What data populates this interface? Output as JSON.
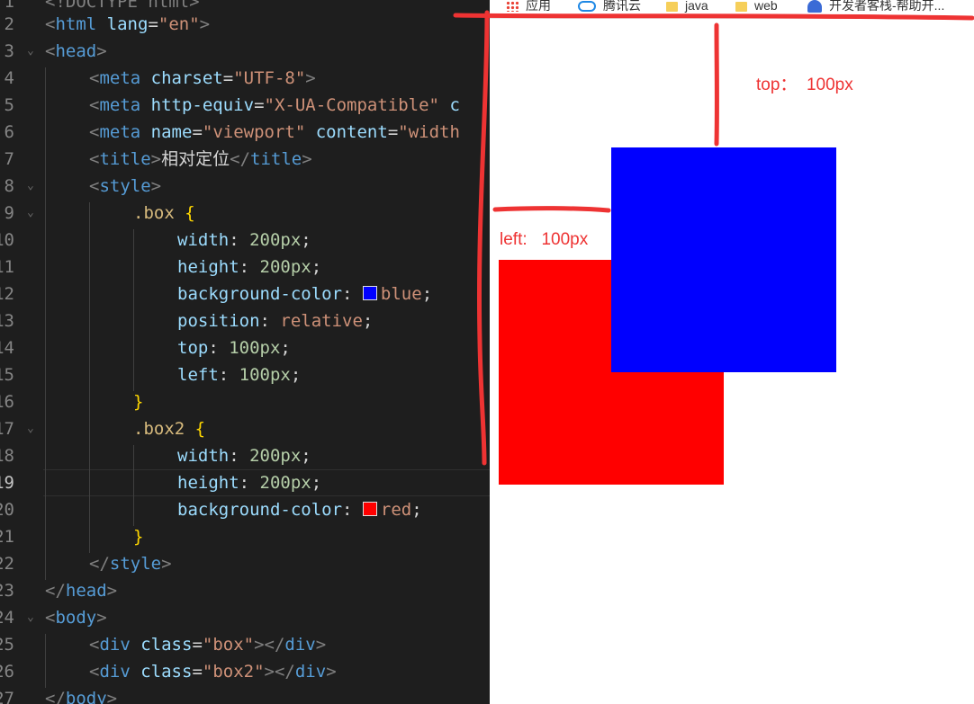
{
  "editor": {
    "line_numbers": [
      "1",
      "2",
      "3",
      "4",
      "5",
      "6",
      "7",
      "8",
      "9",
      "10",
      "11",
      "12",
      "13",
      "14",
      "15",
      "16",
      "17",
      "18",
      "19",
      "20",
      "21",
      "22",
      "23",
      "24",
      "25",
      "26",
      "27"
    ],
    "active_line": "19",
    "code": {
      "l1_text": "<!DOCTYPE html>",
      "l2_lang": "\"en\"",
      "l4_charset": "\"UTF-8\"",
      "l5_equiv": "\"X-UA-Compatible\"",
      "l5_rest": "c",
      "l6_viewport": "\"viewport\"",
      "l6_content": "\"width",
      "l7_title": "相对定位",
      "sel_box": ".box",
      "sel_box2": ".box2",
      "width_value": "200px",
      "height_value": "200px",
      "color_blue": "blue",
      "color_red": "red",
      "position_value": "relative",
      "top_value": "100px",
      "left_value": "100px",
      "class_box": "\"box\"",
      "class_box2": "\"box2\""
    },
    "swatch_colors": {
      "blue": "#0000ff",
      "red": "#ff0000"
    }
  },
  "browser": {
    "bookmarks": [
      {
        "label": "应用",
        "icon": "apps-grid-icon"
      },
      {
        "label": "腾讯云",
        "icon": "cloud-icon"
      },
      {
        "label": "java",
        "icon": "folder-icon"
      },
      {
        "label": "web",
        "icon": "folder-icon"
      },
      {
        "label": "开发者客栈-帮助开...",
        "icon": "site-icon"
      }
    ],
    "box_color": "#0000ff",
    "box2_color": "#ff0000"
  },
  "annotations": {
    "top_label": "top：  100px",
    "left_label": "left:   100px",
    "marker_color": "#ee3333"
  }
}
